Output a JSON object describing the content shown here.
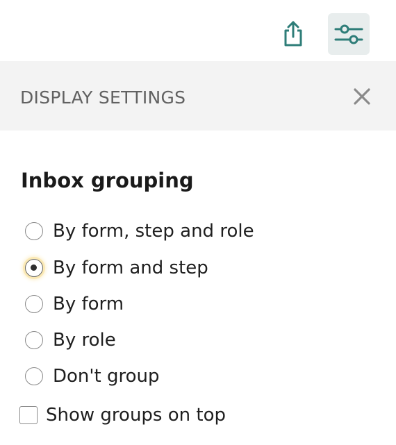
{
  "toolbar": {
    "share_icon": "share-icon",
    "settings_icon": "sliders-icon",
    "accent_color": "#2e7d78"
  },
  "panel": {
    "title": "DISPLAY SETTINGS",
    "close_icon": "close-icon"
  },
  "inbox_grouping": {
    "heading": "Inbox grouping",
    "selected": "By form and step",
    "options": [
      {
        "label": "By form, step and role",
        "checked": false
      },
      {
        "label": "By form and step",
        "checked": true
      },
      {
        "label": "By form",
        "checked": false
      },
      {
        "label": "By role",
        "checked": false
      },
      {
        "label": "Don't group",
        "checked": false
      }
    ]
  },
  "show_groups_on_top": {
    "label": "Show groups on top",
    "checked": false
  }
}
